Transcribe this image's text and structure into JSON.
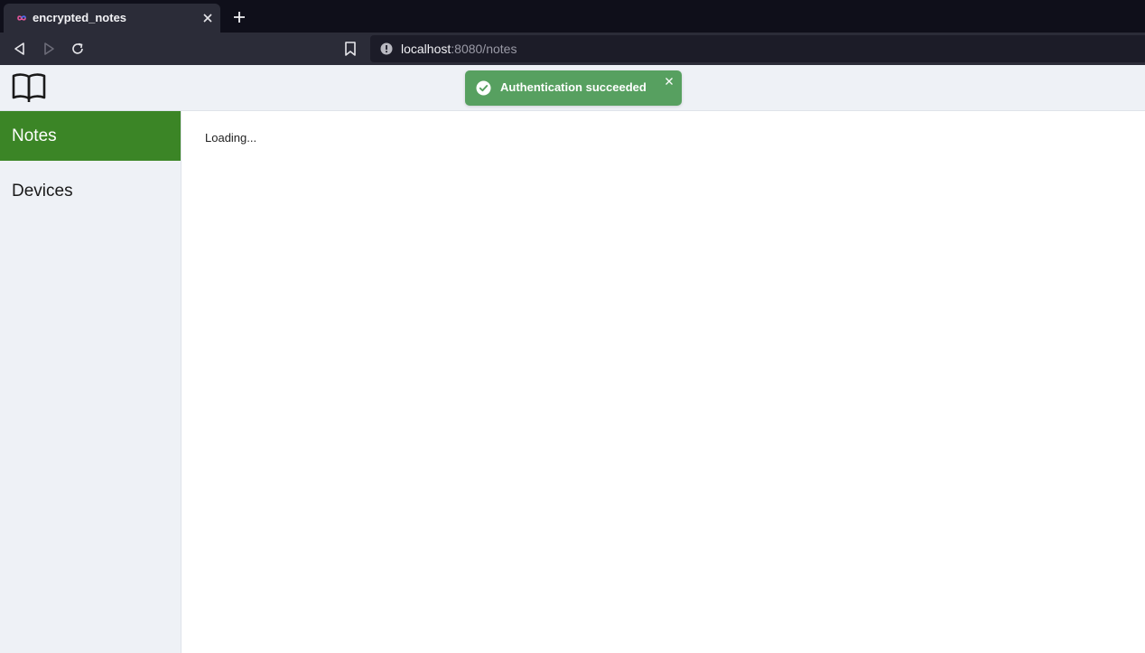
{
  "browser": {
    "tab_title": "encrypted_notes",
    "url_host": "localhost",
    "url_path": ":8080/notes"
  },
  "sidebar": {
    "items": [
      {
        "label": "Notes",
        "active": true
      },
      {
        "label": "Devices",
        "active": false
      }
    ]
  },
  "main": {
    "status": "Loading..."
  },
  "toast": {
    "message": "Authentication succeeded",
    "type": "success"
  },
  "icons": {
    "logo": "open-book-icon",
    "toast": "check-circle-icon"
  },
  "colors": {
    "accent": "#3b8526",
    "toast_bg": "#57a060",
    "sidebar_bg": "#eef1f6",
    "browser_bg": "#2b2c38"
  }
}
